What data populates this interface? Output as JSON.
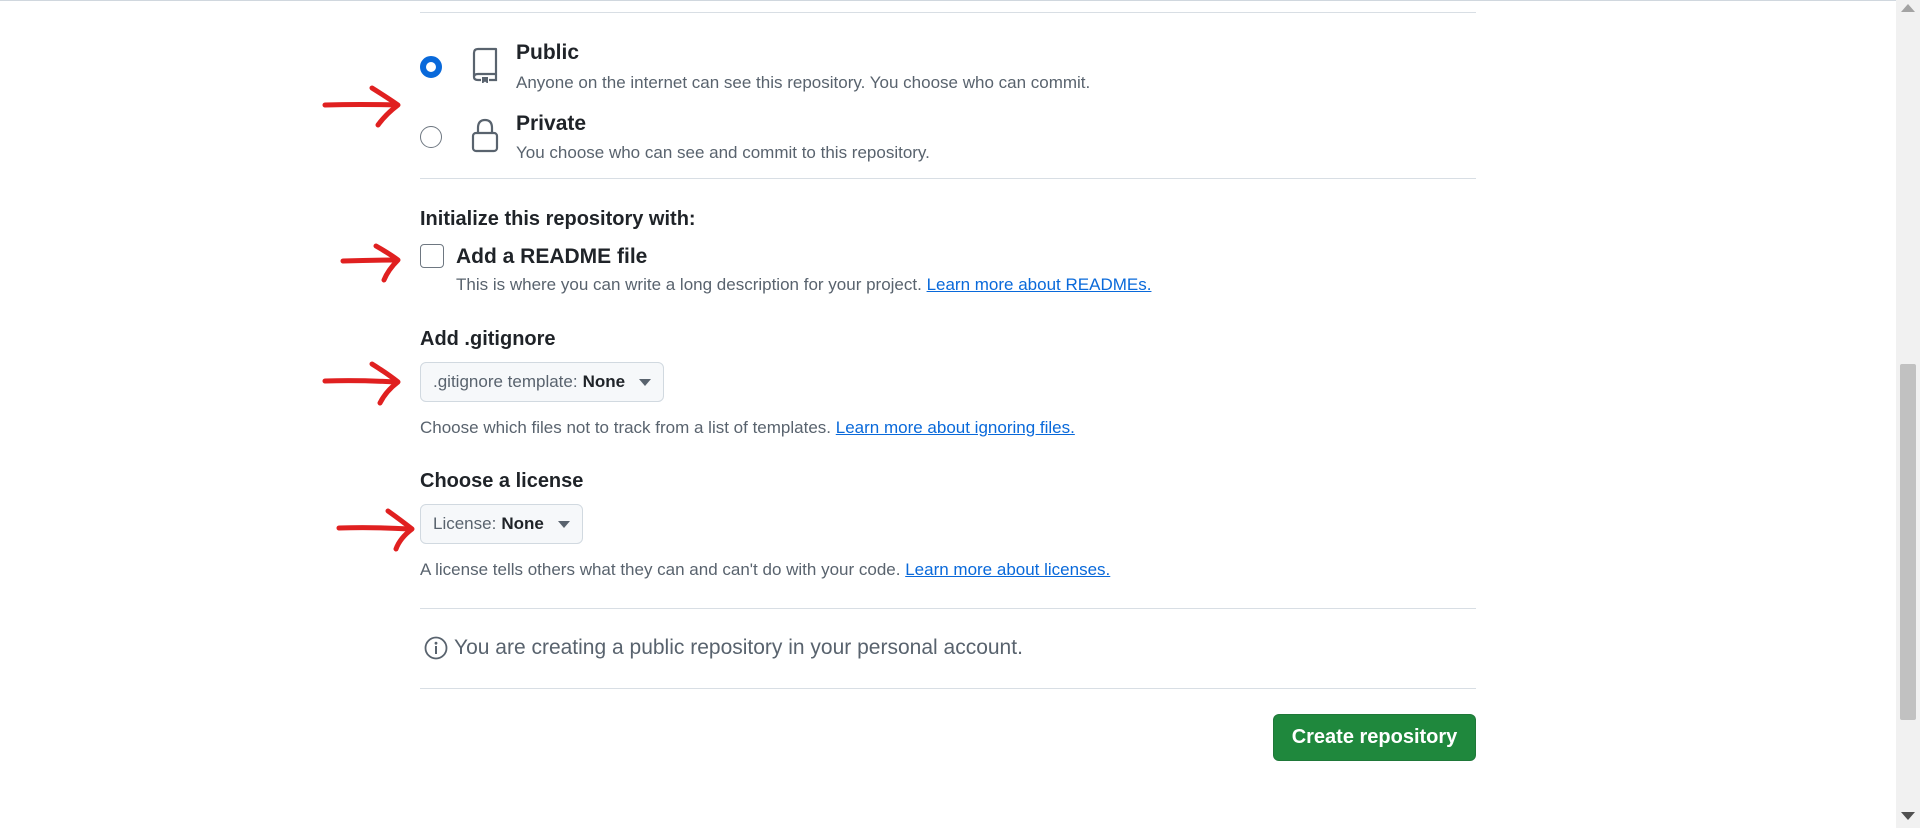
{
  "visibility": {
    "public": {
      "title": "Public",
      "description": "Anyone on the internet can see this repository. You choose who can commit.",
      "selected": true
    },
    "private": {
      "title": "Private",
      "description": "You choose who can see and commit to this repository.",
      "selected": false
    }
  },
  "initialize": {
    "heading": "Initialize this repository with:",
    "readme_label": "Add a README file",
    "readme_desc": "This is where you can write a long description for your project.",
    "readme_link": "Learn more about READMEs.",
    "readme_checked": false
  },
  "gitignore": {
    "heading": "Add .gitignore",
    "select_prefix": ".gitignore template:",
    "select_value": "None",
    "desc": "Choose which files not to track from a list of templates.",
    "link": "Learn more about ignoring files."
  },
  "license": {
    "heading": "Choose a license",
    "select_prefix": "License:",
    "select_value": "None",
    "desc": "A license tells others what they can and can't do with your code.",
    "link": "Learn more about licenses."
  },
  "info": {
    "text": "You are creating a public repository in your personal account."
  },
  "actions": {
    "create_label": "Create repository"
  },
  "colors": {
    "accent": "#0969da",
    "primary_button": "#1f883d",
    "annotation_arrow": "#e02020"
  },
  "icons": [
    "repo-icon",
    "lock-icon",
    "info-icon",
    "triangle-down-icon",
    "red-arrow-annotation"
  ]
}
